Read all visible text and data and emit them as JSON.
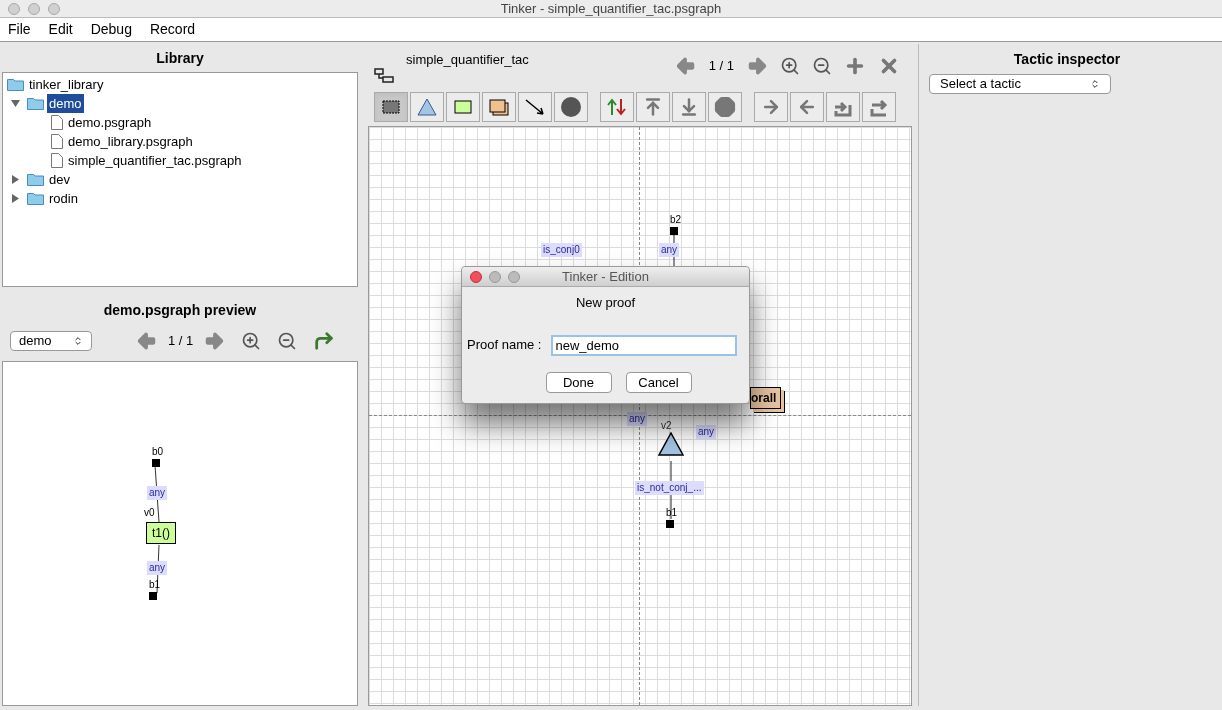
{
  "window": {
    "title": "Tinker - simple_quantifier_tac.psgraph"
  },
  "menu": [
    "File",
    "Edit",
    "Debug",
    "Record"
  ],
  "library": {
    "title": "Library",
    "tree": [
      {
        "label": "tinker_library",
        "kind": "root",
        "selected": false,
        "children": [
          {
            "label": "demo",
            "kind": "folder",
            "expanded": true,
            "selected": true,
            "children": [
              {
                "label": "demo.psgraph",
                "kind": "file",
                "selected": false
              },
              {
                "label": "demo_library.psgraph",
                "kind": "file",
                "selected": false
              },
              {
                "label": "simple_quantifier_tac.psgraph",
                "kind": "file",
                "selected": false
              }
            ]
          },
          {
            "label": "dev",
            "kind": "folder",
            "expanded": false,
            "selected": false
          },
          {
            "label": "rodin",
            "kind": "folder",
            "expanded": false,
            "selected": false
          }
        ]
      }
    ]
  },
  "preview": {
    "title": "demo.psgraph preview",
    "graph_select": "demo",
    "page": "1 / 1",
    "graph": [
      {
        "kind": "boundary",
        "label": "b0"
      },
      {
        "kind": "edge_label",
        "label": "any"
      },
      {
        "kind": "vertex_name",
        "label": "v0"
      },
      {
        "kind": "tactic",
        "label": "t1()"
      },
      {
        "kind": "edge_label",
        "label": "any"
      },
      {
        "kind": "boundary",
        "label": "b1"
      }
    ]
  },
  "editor": {
    "title": "simple_quantifier_tac",
    "page": "1 / 1",
    "tools": [
      {
        "kind": "select",
        "selected": true
      },
      {
        "kind": "identity",
        "selected": false
      },
      {
        "kind": "atomic",
        "selected": false
      },
      {
        "kind": "nested",
        "selected": false
      },
      {
        "kind": "edge",
        "selected": false
      },
      {
        "kind": "break",
        "selected": false
      }
    ],
    "graph": [
      {
        "kind": "boundary",
        "label": "b2"
      },
      {
        "kind": "edge_label",
        "label": "any"
      },
      {
        "kind": "edge_label",
        "label": "is_conj0"
      },
      {
        "kind": "nested",
        "label": "orall"
      },
      {
        "kind": "edge_label",
        "label": "any"
      },
      {
        "kind": "vertex_name",
        "label": "v2"
      },
      {
        "kind": "edge_label",
        "label": "any"
      },
      {
        "kind": "identity"
      },
      {
        "kind": "edge_label",
        "label": "is_not_conj_..."
      },
      {
        "kind": "boundary",
        "label": "b1"
      }
    ]
  },
  "inspector": {
    "title": "Tactic inspector",
    "select": "Select a tactic"
  },
  "dialog": {
    "title": "Tinker - Edition",
    "heading": "New proof",
    "field_label": "Proof name :",
    "value": "new_demo",
    "buttons": [
      "Done",
      "Cancel"
    ]
  }
}
